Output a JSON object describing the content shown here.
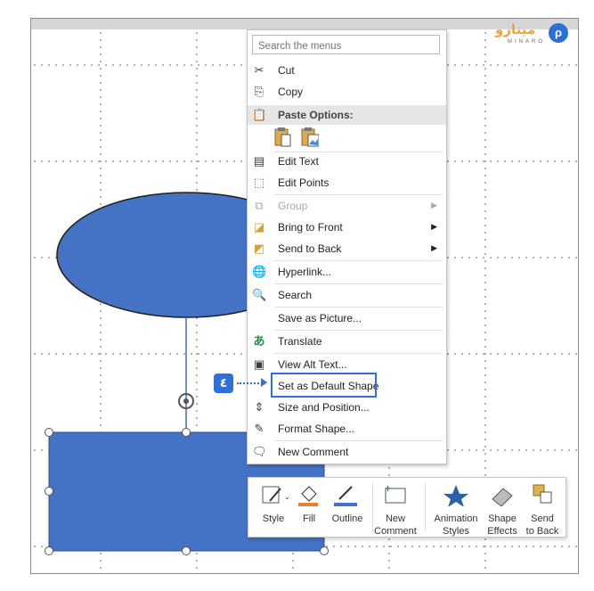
{
  "menu": {
    "search_placeholder": "Search the menus",
    "cut": "Cut",
    "copy": "Copy",
    "paste_options": "Paste Options:",
    "edit_text": "Edit Text",
    "edit_points": "Edit Points",
    "group": "Group",
    "bring_to_front": "Bring to Front",
    "send_to_back": "Send to Back",
    "hyperlink": "Hyperlink...",
    "search": "Search",
    "save_as_picture": "Save as Picture...",
    "translate": "Translate",
    "view_alt_text": "View Alt Text...",
    "set_default_shape": "Set as Default Shape",
    "size_and_position": "Size and Position...",
    "format_shape": "Format Shape...",
    "new_comment": "New Comment"
  },
  "toolbar": {
    "style": "Style",
    "fill": "Fill",
    "outline": "Outline",
    "new_comment_1": "New",
    "new_comment_2": "Comment",
    "animation_1": "Animation",
    "animation_2": "Styles",
    "effects_1": "Shape",
    "effects_2": "Effects",
    "send_back_1": "Send",
    "send_back_2": "to Back"
  },
  "annotation": {
    "step_number": "٤"
  },
  "logo": {
    "text": "مینارو",
    "subtext": "MINARO"
  },
  "colors": {
    "shape_fill": "#4472c4",
    "highlight": "#2f6fdb",
    "fill_bar": "#ed7d31"
  }
}
